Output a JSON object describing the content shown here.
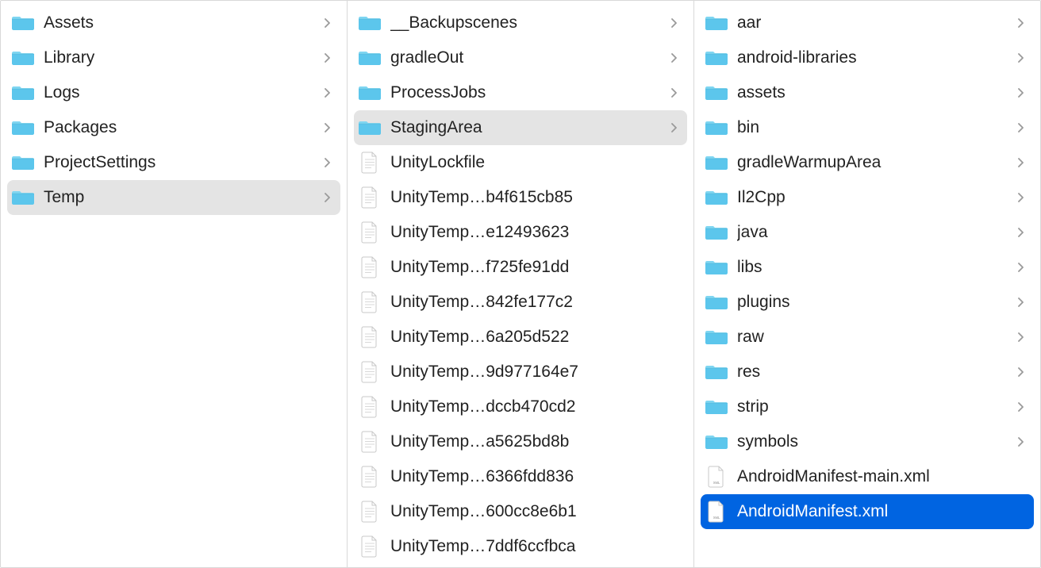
{
  "colors": {
    "folder_top": "#7fd6f2",
    "folder_body": "#5cc6ec",
    "file_fill": "#ffffff",
    "file_stroke": "#c8c8c8",
    "selection_grey": "#e4e4e4",
    "selection_blue": "#0064e1",
    "xml_label": "XML"
  },
  "columns": [
    {
      "id": "col1",
      "items": [
        {
          "name": "Assets",
          "type": "folder",
          "has_children": true,
          "state": "none"
        },
        {
          "name": "Library",
          "type": "folder",
          "has_children": true,
          "state": "none"
        },
        {
          "name": "Logs",
          "type": "folder",
          "has_children": true,
          "state": "none"
        },
        {
          "name": "Packages",
          "type": "folder",
          "has_children": true,
          "state": "none"
        },
        {
          "name": "ProjectSettings",
          "type": "folder",
          "has_children": true,
          "state": "none"
        },
        {
          "name": "Temp",
          "type": "folder",
          "has_children": true,
          "state": "grey"
        }
      ]
    },
    {
      "id": "col2",
      "items": [
        {
          "name": "__Backupscenes",
          "type": "folder",
          "has_children": true,
          "state": "none"
        },
        {
          "name": "gradleOut",
          "type": "folder",
          "has_children": true,
          "state": "none"
        },
        {
          "name": "ProcessJobs",
          "type": "folder",
          "has_children": true,
          "state": "none"
        },
        {
          "name": "StagingArea",
          "type": "folder",
          "has_children": true,
          "state": "grey"
        },
        {
          "name": "UnityLockfile",
          "type": "file",
          "has_children": false,
          "state": "none"
        },
        {
          "name": "UnityTemp…b4f615cb85",
          "type": "file",
          "has_children": false,
          "state": "none"
        },
        {
          "name": "UnityTemp…e12493623",
          "type": "file",
          "has_children": false,
          "state": "none"
        },
        {
          "name": "UnityTemp…f725fe91dd",
          "type": "file",
          "has_children": false,
          "state": "none"
        },
        {
          "name": "UnityTemp…842fe177c2",
          "type": "file",
          "has_children": false,
          "state": "none"
        },
        {
          "name": "UnityTemp…6a205d522",
          "type": "file",
          "has_children": false,
          "state": "none"
        },
        {
          "name": "UnityTemp…9d977164e7",
          "type": "file",
          "has_children": false,
          "state": "none"
        },
        {
          "name": "UnityTemp…dccb470cd2",
          "type": "file",
          "has_children": false,
          "state": "none"
        },
        {
          "name": "UnityTemp…a5625bd8b",
          "type": "file",
          "has_children": false,
          "state": "none"
        },
        {
          "name": "UnityTemp…6366fdd836",
          "type": "file",
          "has_children": false,
          "state": "none"
        },
        {
          "name": "UnityTemp…600cc8e6b1",
          "type": "file",
          "has_children": false,
          "state": "none"
        },
        {
          "name": "UnityTemp…7ddf6ccfbca",
          "type": "file",
          "has_children": false,
          "state": "none"
        }
      ]
    },
    {
      "id": "col3",
      "items": [
        {
          "name": "aar",
          "type": "folder",
          "has_children": true,
          "state": "none"
        },
        {
          "name": "android-libraries",
          "type": "folder",
          "has_children": true,
          "state": "none"
        },
        {
          "name": "assets",
          "type": "folder",
          "has_children": true,
          "state": "none"
        },
        {
          "name": "bin",
          "type": "folder",
          "has_children": true,
          "state": "none"
        },
        {
          "name": "gradleWarmupArea",
          "type": "folder",
          "has_children": true,
          "state": "none"
        },
        {
          "name": "Il2Cpp",
          "type": "folder",
          "has_children": true,
          "state": "none"
        },
        {
          "name": "java",
          "type": "folder",
          "has_children": true,
          "state": "none"
        },
        {
          "name": "libs",
          "type": "folder",
          "has_children": true,
          "state": "none"
        },
        {
          "name": "plugins",
          "type": "folder",
          "has_children": true,
          "state": "none"
        },
        {
          "name": "raw",
          "type": "folder",
          "has_children": true,
          "state": "none"
        },
        {
          "name": "res",
          "type": "folder",
          "has_children": true,
          "state": "none"
        },
        {
          "name": "strip",
          "type": "folder",
          "has_children": true,
          "state": "none"
        },
        {
          "name": "symbols",
          "type": "folder",
          "has_children": true,
          "state": "none"
        },
        {
          "name": "AndroidManifest-main.xml",
          "type": "xml",
          "has_children": false,
          "state": "none"
        },
        {
          "name": "AndroidManifest.xml",
          "type": "xml",
          "has_children": false,
          "state": "blue"
        }
      ]
    }
  ]
}
